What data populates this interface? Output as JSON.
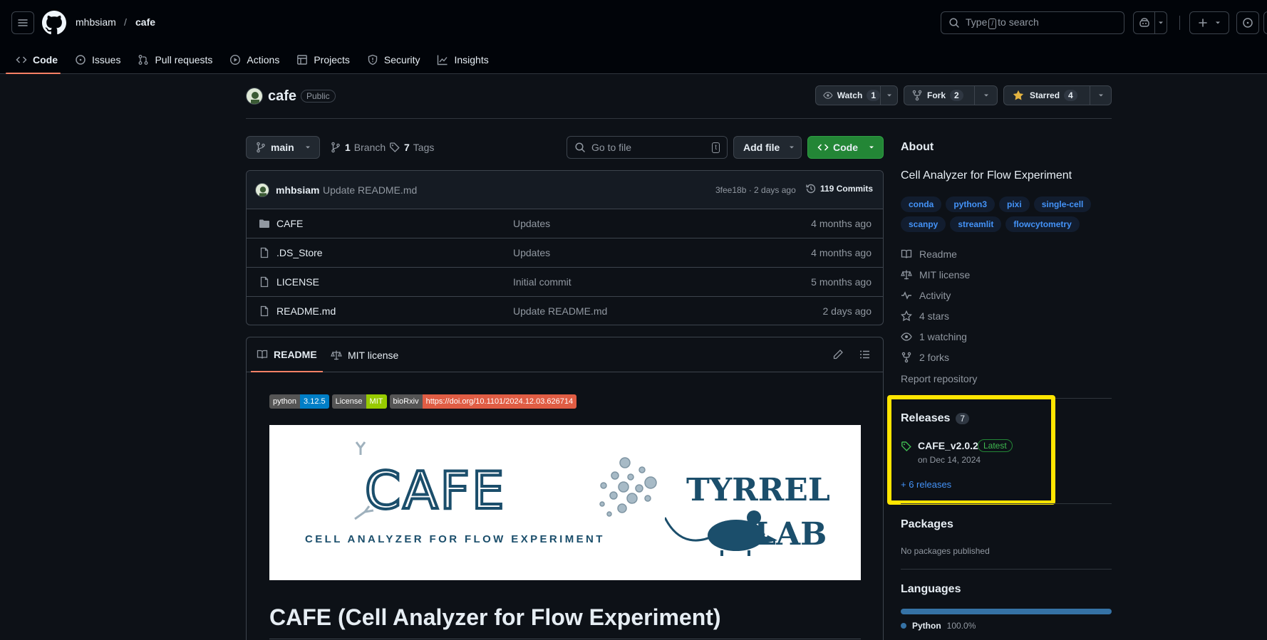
{
  "header": {
    "owner": "mhbsiam",
    "slash": "/",
    "repo": "cafe",
    "search_type": "Type",
    "search_key": "/",
    "search_rest": "to search"
  },
  "nav": [
    {
      "label": "Code",
      "icon": "code-icon"
    },
    {
      "label": "Issues",
      "icon": "issue-icon"
    },
    {
      "label": "Pull requests",
      "icon": "pull-request-icon"
    },
    {
      "label": "Actions",
      "icon": "play-icon"
    },
    {
      "label": "Projects",
      "icon": "table-icon"
    },
    {
      "label": "Security",
      "icon": "shield-icon"
    },
    {
      "label": "Insights",
      "icon": "graph-icon"
    }
  ],
  "repo": {
    "name": "cafe",
    "visibility": "Public",
    "watch_label": "Watch",
    "watch_count": "1",
    "fork_label": "Fork",
    "fork_count": "2",
    "star_label": "Starred",
    "star_count": "4"
  },
  "toolbar": {
    "branch": "main",
    "branch_count": "1",
    "branch_label": "Branch",
    "tag_count": "7",
    "tag_label": "Tags",
    "go_to_file": "Go to file",
    "go_key": "t",
    "add_file": "Add file",
    "code": "Code"
  },
  "commit": {
    "author": "mhbsiam",
    "message": "Update README.md",
    "meta": "3fee18b · 2 days ago",
    "commits": "119 Commits"
  },
  "files": [
    {
      "name": "CAFE",
      "type": "folder",
      "message": "Updates",
      "age": "4 months ago"
    },
    {
      "name": ".DS_Store",
      "type": "file",
      "message": "Updates",
      "age": "4 months ago"
    },
    {
      "name": "LICENSE",
      "type": "file",
      "message": "Initial commit",
      "age": "5 months ago"
    },
    {
      "name": "README.md",
      "type": "file",
      "message": "Update README.md",
      "age": "2 days ago"
    }
  ],
  "readme": {
    "tab_readme": "README",
    "tab_license": "MIT license",
    "badges": [
      {
        "left": "python",
        "right": "3.12.5",
        "color": "#007ec6"
      },
      {
        "left": "License",
        "right": "MIT",
        "color": "#97ca00"
      },
      {
        "left": "bioRxiv",
        "right": "https://doi.org/10.1101/2024.12.03.626714",
        "color": "#e05d44"
      }
    ],
    "banner_cafe": "CAFE",
    "banner_sub": "CELL ANALYZER FOR FLOW EXPERIMENT",
    "banner_lab_top": "TYRREL",
    "banner_lab_bottom": "LAB",
    "heading": "CAFE (Cell Analyzer for Flow Experiment)"
  },
  "about": {
    "title": "About",
    "description": "Cell Analyzer for Flow Experiment",
    "topics": [
      "conda",
      "python3",
      "pixi",
      "single-cell",
      "scanpy",
      "streamlit",
      "flowcytometry"
    ],
    "links": [
      {
        "label": "Readme",
        "icon": "book-icon"
      },
      {
        "label": "MIT license",
        "icon": "law-icon"
      },
      {
        "label": "Activity",
        "icon": "pulse-icon"
      },
      {
        "label": "4 stars",
        "icon": "star-icon"
      },
      {
        "label": "1 watching",
        "icon": "eye-icon"
      },
      {
        "label": "2 forks",
        "icon": "fork-icon"
      }
    ],
    "report": "Report repository"
  },
  "releases": {
    "title": "Releases",
    "count": "7",
    "latest_name": "CAFE_v2.0.2",
    "latest_badge": "Latest",
    "latest_date": "on Dec 14, 2024",
    "more": "+ 6 releases"
  },
  "packages": {
    "title": "Packages",
    "empty": "No packages published"
  },
  "languages": {
    "title": "Languages",
    "items": [
      {
        "name": "Python",
        "percent": "100.0%",
        "color": "#3572A5"
      }
    ]
  },
  "colors": {
    "accent": "#f78166",
    "link": "#4493f8",
    "green": "#238636",
    "highlight": "#ffe500"
  }
}
